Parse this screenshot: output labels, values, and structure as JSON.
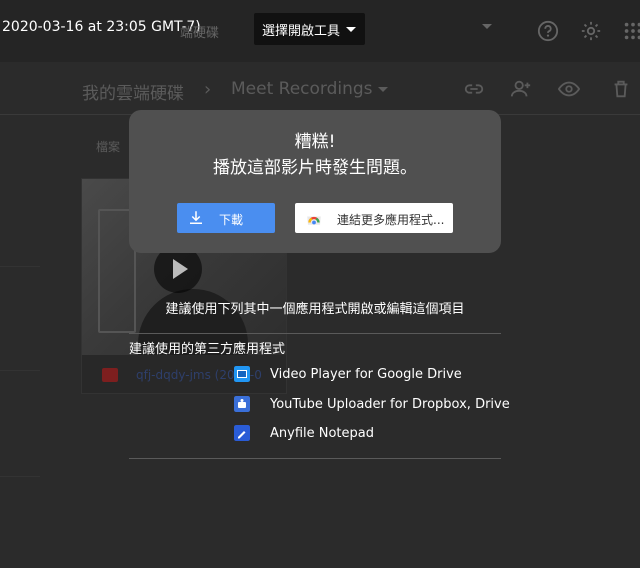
{
  "window": {
    "title": "2020-03-16 at 23:05 GMT-7)",
    "behind_title": "端硬碟"
  },
  "toolbar": {
    "open_with_label": "選擇開啟工具",
    "icons": [
      "help-icon",
      "gear-icon",
      "apps-grid-icon"
    ]
  },
  "breadcrumb": {
    "root": "我的雲端硬碟",
    "separator": "›",
    "current": "Meet Recordings"
  },
  "header_actions": [
    "link-icon",
    "add-person-icon",
    "eye-icon",
    "trash-icon"
  ],
  "file_list": {
    "label": "檔案",
    "file": {
      "name": "qfj-dqdy-jms (2020-0",
      "icon": "video-file-icon"
    }
  },
  "error_dialog": {
    "title": "糟糕!",
    "message": "播放這部影片時發生問題。",
    "download_label": "下載",
    "connect_label": "連結更多應用程式...",
    "colors": {
      "primary": "#4a8ef0",
      "dialog_bg": "#505050"
    }
  },
  "suggestions": {
    "heading": "建議使用下列其中一個應用程式開啟或編輯這個項目",
    "third_party_label": "建議使用的第三方應用程式",
    "apps": [
      {
        "name": "Video Player for Google Drive",
        "icon": "video-player-icon",
        "color": "#2196f3"
      },
      {
        "name": "YouTube Uploader for Dropbox, Drive",
        "icon": "youtube-uploader-icon",
        "color": "#3a6fd8"
      },
      {
        "name": "Anyfile Notepad",
        "icon": "notepad-icon",
        "color": "#2a5cd6"
      }
    ]
  }
}
